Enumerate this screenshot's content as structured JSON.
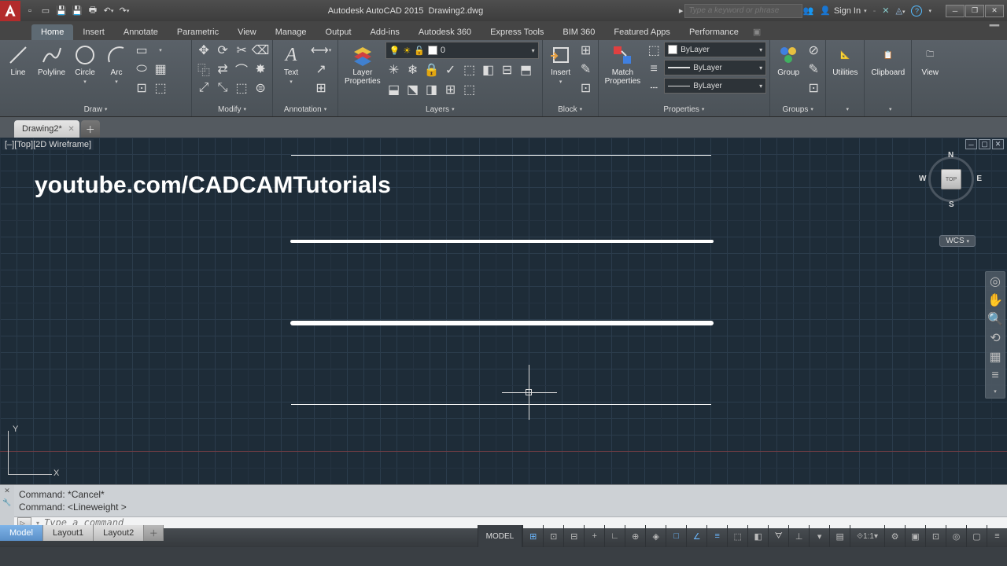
{
  "title": {
    "app": "Autodesk AutoCAD 2015",
    "doc": "Drawing2.dwg"
  },
  "search_placeholder": "Type a keyword or phrase",
  "signin": "Sign In",
  "ribbon_tabs": [
    "Home",
    "Insert",
    "Annotate",
    "Parametric",
    "View",
    "Manage",
    "Output",
    "Add-ins",
    "Autodesk 360",
    "Express Tools",
    "BIM 360",
    "Featured Apps",
    "Performance"
  ],
  "active_ribbon_tab": "Home",
  "panels": {
    "draw": {
      "title": "Draw",
      "tools": [
        "Line",
        "Polyline",
        "Circle",
        "Arc"
      ]
    },
    "modify": {
      "title": "Modify"
    },
    "annotation": {
      "title": "Annotation",
      "tool": "Text"
    },
    "layers": {
      "title": "Layers",
      "tool": "Layer\nProperties",
      "current": "0"
    },
    "block": {
      "title": "Block",
      "tool": "Insert"
    },
    "properties": {
      "title": "Properties",
      "tool": "Match\nProperties",
      "color": "ByLayer",
      "lw": "ByLayer",
      "lt": "ByLayer"
    },
    "groups": {
      "title": "Groups",
      "tool": "Group"
    },
    "utilities": {
      "title": "Utilities"
    },
    "clipboard": {
      "title": "Clipboard"
    },
    "view": {
      "title": "View"
    }
  },
  "file_tab": "Drawing2*",
  "viewport_label": "[–][Top][2D Wireframe]",
  "watermark": "youtube.com/CADCAMTutorials",
  "viewcube": {
    "face": "TOP",
    "n": "N",
    "s": "S",
    "e": "E",
    "w": "W"
  },
  "wcs": "WCS",
  "ucs": {
    "x": "X",
    "y": "Y"
  },
  "cmd_history": [
    "Command: *Cancel*",
    "Command:  <Lineweight >"
  ],
  "cmd_placeholder": "Type a command",
  "status": {
    "tabs": [
      "Model",
      "Layout1",
      "Layout2"
    ],
    "model": "MODEL",
    "scale": "1:1"
  }
}
